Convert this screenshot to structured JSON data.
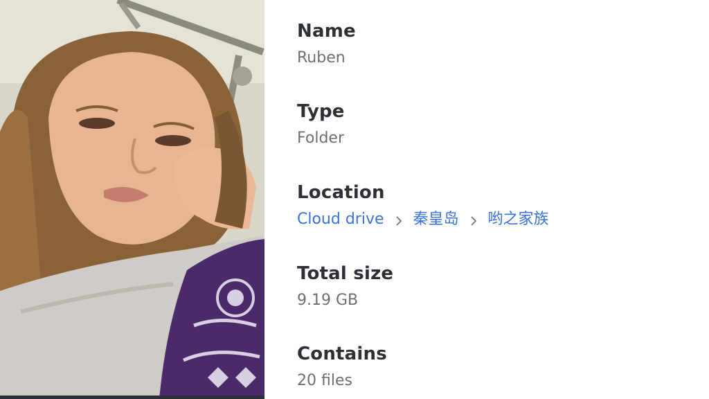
{
  "photo": {
    "description_icon": "photo-thumbnail"
  },
  "details": {
    "name": {
      "label": "Name",
      "value": "Ruben"
    },
    "type": {
      "label": "Type",
      "value": "Folder"
    },
    "location": {
      "label": "Location",
      "path": [
        "Cloud drive",
        "秦皇岛",
        "哟之家族"
      ],
      "separator_icon": "chevron-right-icon"
    },
    "total_size": {
      "label": "Total size",
      "value": "9.19 GB"
    },
    "contains": {
      "label": "Contains",
      "value": "20 files"
    }
  },
  "colors": {
    "label": "#2c3036",
    "value": "#6b6f75",
    "link": "#3a73d6"
  }
}
